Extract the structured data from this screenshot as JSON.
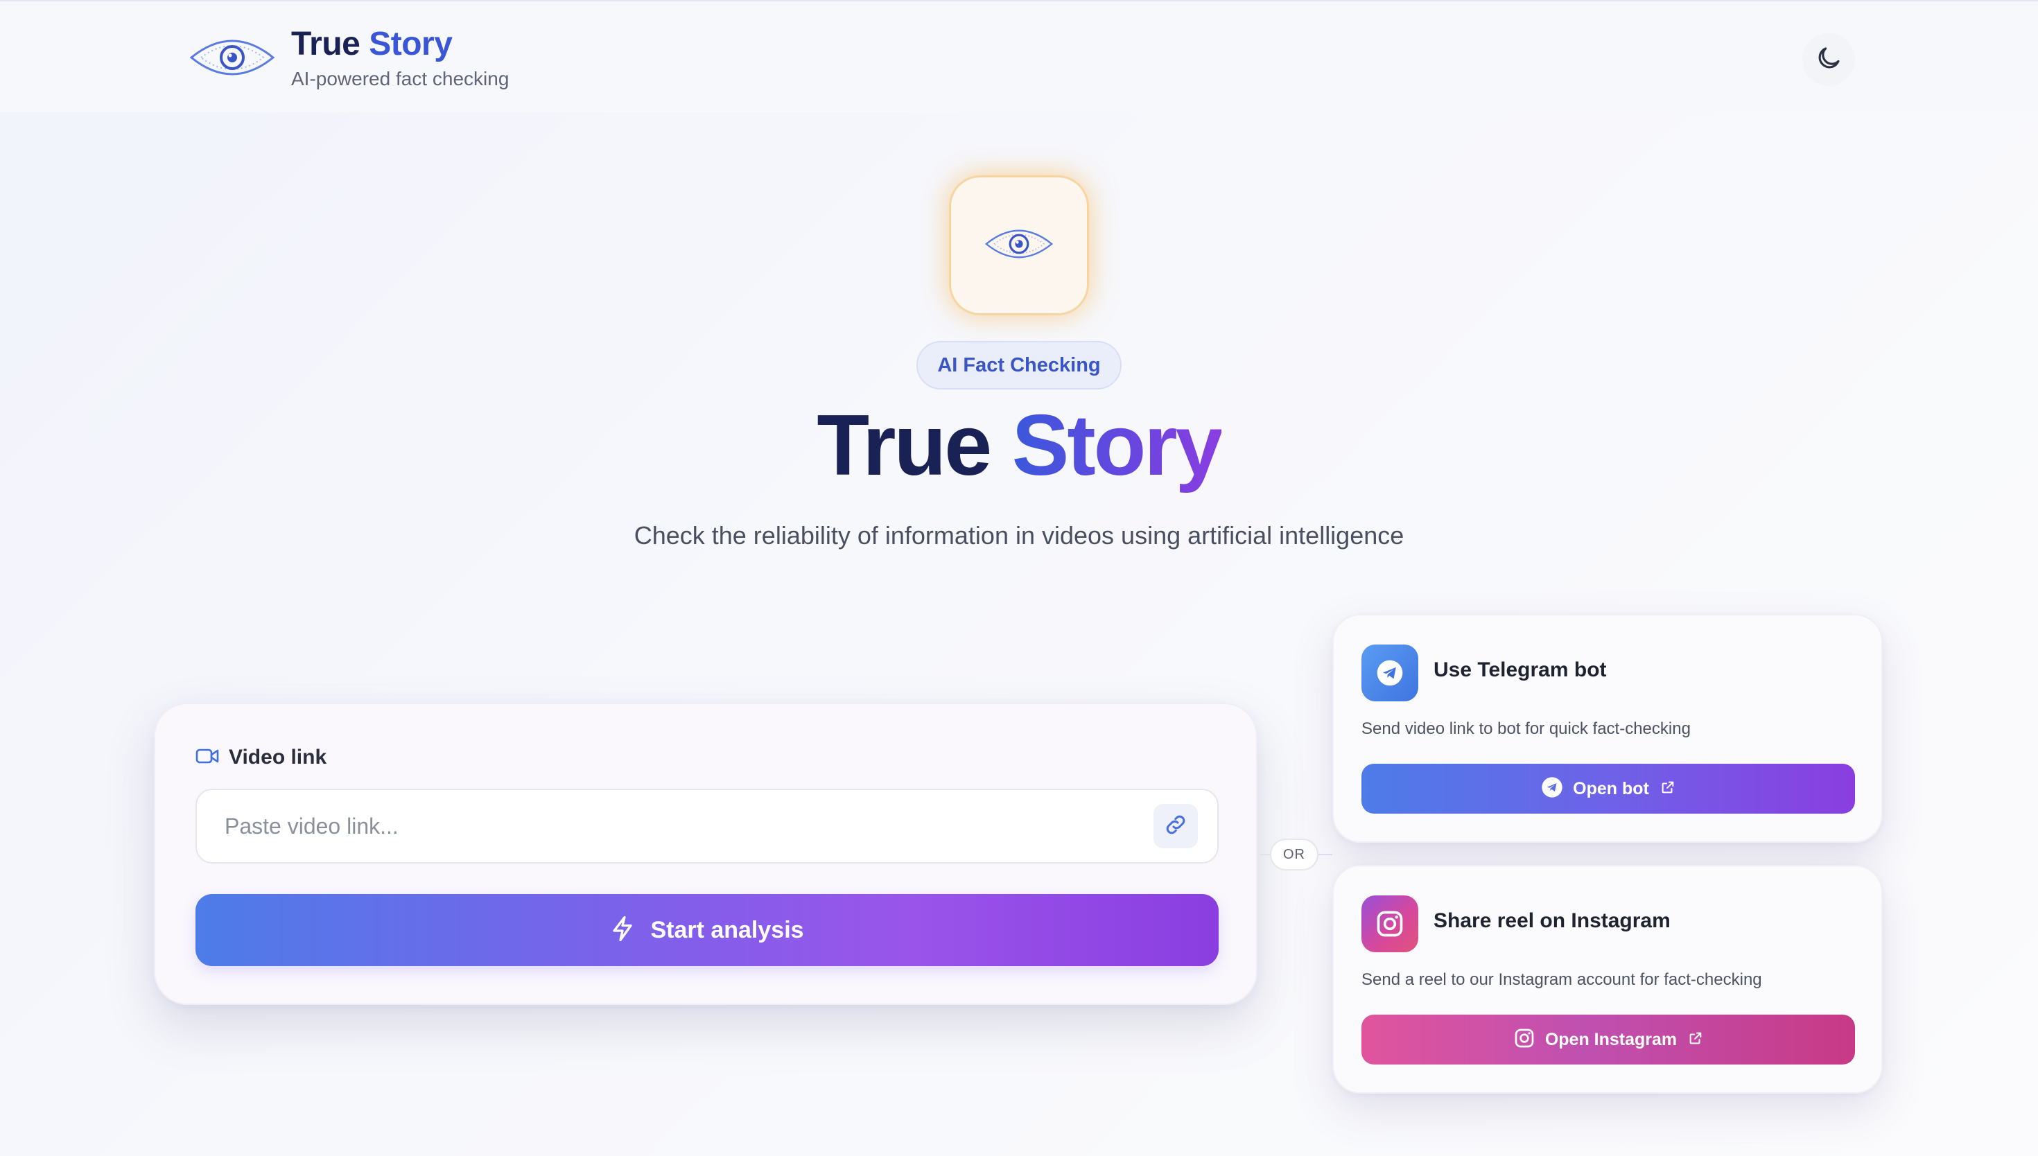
{
  "header": {
    "brand_title_part1": "True",
    "brand_title_part2": "Story",
    "brand_subtitle": "AI-powered fact checking",
    "logo_icon": "eye-icon",
    "theme_toggle_icon": "moon-icon"
  },
  "hero": {
    "icon": "eye-icon",
    "badge": "AI Fact Checking",
    "title_part1": "True",
    "title_part2": "Story",
    "subtitle": "Check the reliability of information in videos using artificial intelligence"
  },
  "input_card": {
    "label_icon": "video-camera-icon",
    "label": "Video link",
    "input_value": "",
    "input_placeholder": "Paste video link...",
    "link_icon": "link-icon",
    "start_icon": "lightning-icon",
    "start_label": "Start analysis"
  },
  "separator": {
    "or_label": "OR"
  },
  "telegram_card": {
    "icon": "telegram-icon",
    "title": "Use Telegram bot",
    "description": "Send video link to bot for quick fact-checking",
    "button_label": "Open bot",
    "button_icon": "telegram-icon",
    "button_trailing_icon": "external-link-icon"
  },
  "instagram_card": {
    "icon": "instagram-icon",
    "title": "Share reel on Instagram",
    "description": "Send a reel to our Instagram account for fact-checking",
    "button_label": "Open Instagram",
    "button_icon": "instagram-icon",
    "button_trailing_icon": "external-link-icon"
  },
  "colors": {
    "brand_dark": "#1a2154",
    "brand_blue": "#3a55d6",
    "brand_purple": "#8a3ee0",
    "instagram_pink": "#e0549c",
    "hero_glow": "#f6ba5c"
  }
}
